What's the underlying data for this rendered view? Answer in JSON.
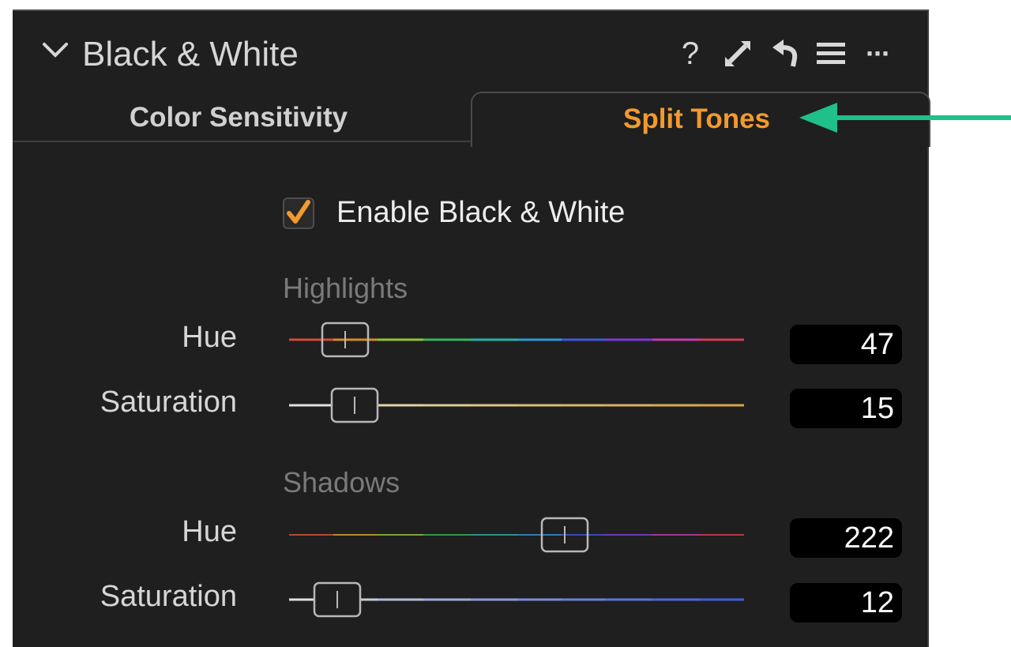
{
  "panel": {
    "title": "Black & White",
    "header_icons": [
      "chevron-down-icon",
      "help-icon",
      "expand-icon",
      "reset-icon",
      "list-icon",
      "more-icon"
    ],
    "help_glyph": "?",
    "more_glyph": "···"
  },
  "tabs": [
    {
      "label": "Color Sensitivity",
      "active": false
    },
    {
      "label": "Split Tones",
      "active": true
    }
  ],
  "enable": {
    "label": "Enable Black & White",
    "checked": true
  },
  "highlights": {
    "section_label": "Highlights",
    "hue": {
      "label": "Hue",
      "value": "47"
    },
    "saturation": {
      "label": "Saturation",
      "value": "15"
    }
  },
  "shadows": {
    "section_label": "Shadows",
    "hue": {
      "label": "Hue",
      "value": "222"
    },
    "saturation": {
      "label": "Saturation",
      "value": "12"
    }
  },
  "colors": {
    "accent": "#f29a2e",
    "annotation_arrow": "#1fc08a",
    "panel_bg": "#1f1f1f"
  }
}
